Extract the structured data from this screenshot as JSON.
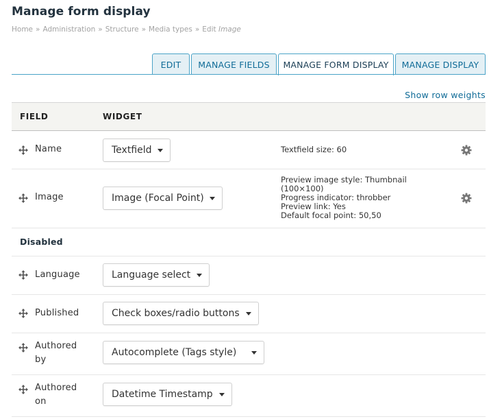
{
  "page": {
    "title": "Manage form display"
  },
  "breadcrumb": {
    "items": [
      "Home",
      "Administration",
      "Structure",
      "Media types",
      "Edit"
    ],
    "current_em": "Image",
    "separator": "»"
  },
  "tabs": [
    {
      "label": "EDIT",
      "active": false
    },
    {
      "label": "MANAGE FIELDS",
      "active": false
    },
    {
      "label": "MANAGE FORM DISPLAY",
      "active": true
    },
    {
      "label": "MANAGE DISPLAY",
      "active": false
    }
  ],
  "row_weights_link": "Show row weights",
  "table": {
    "headers": {
      "field": "FIELD",
      "widget": "WIDGET"
    },
    "rows": [
      {
        "field": "Name",
        "widget": "Textfield",
        "summary": [
          "Textfield size: 60"
        ],
        "has_settings": true
      },
      {
        "field": "Image",
        "widget": "Image (Focal Point)",
        "summary": [
          "Preview image style: Thumbnail",
          "(100×100)",
          "Progress indicator: throbber",
          "Preview link: Yes",
          "Default focal point: 50,50"
        ],
        "has_settings": true
      }
    ],
    "disabled_title": "Disabled",
    "disabled_rows": [
      {
        "field": "Language",
        "widget": "Language select"
      },
      {
        "field": "Published",
        "widget": "Check boxes/radio buttons"
      },
      {
        "field_line1": "Authored",
        "field_line2": "by",
        "widget": "Autocomplete (Tags style)"
      },
      {
        "field_line1": "Authored",
        "field_line2": "on",
        "widget": "Datetime Timestamp"
      }
    ]
  },
  "icons": {
    "drag": "drag-handle-icon",
    "settings": "gear-icon",
    "dropdown": "chevron-down-icon"
  },
  "colors": {
    "link": "#0f6b97",
    "tab_border": "#4aa3c7",
    "tab_bg": "#e4f0f5"
  }
}
